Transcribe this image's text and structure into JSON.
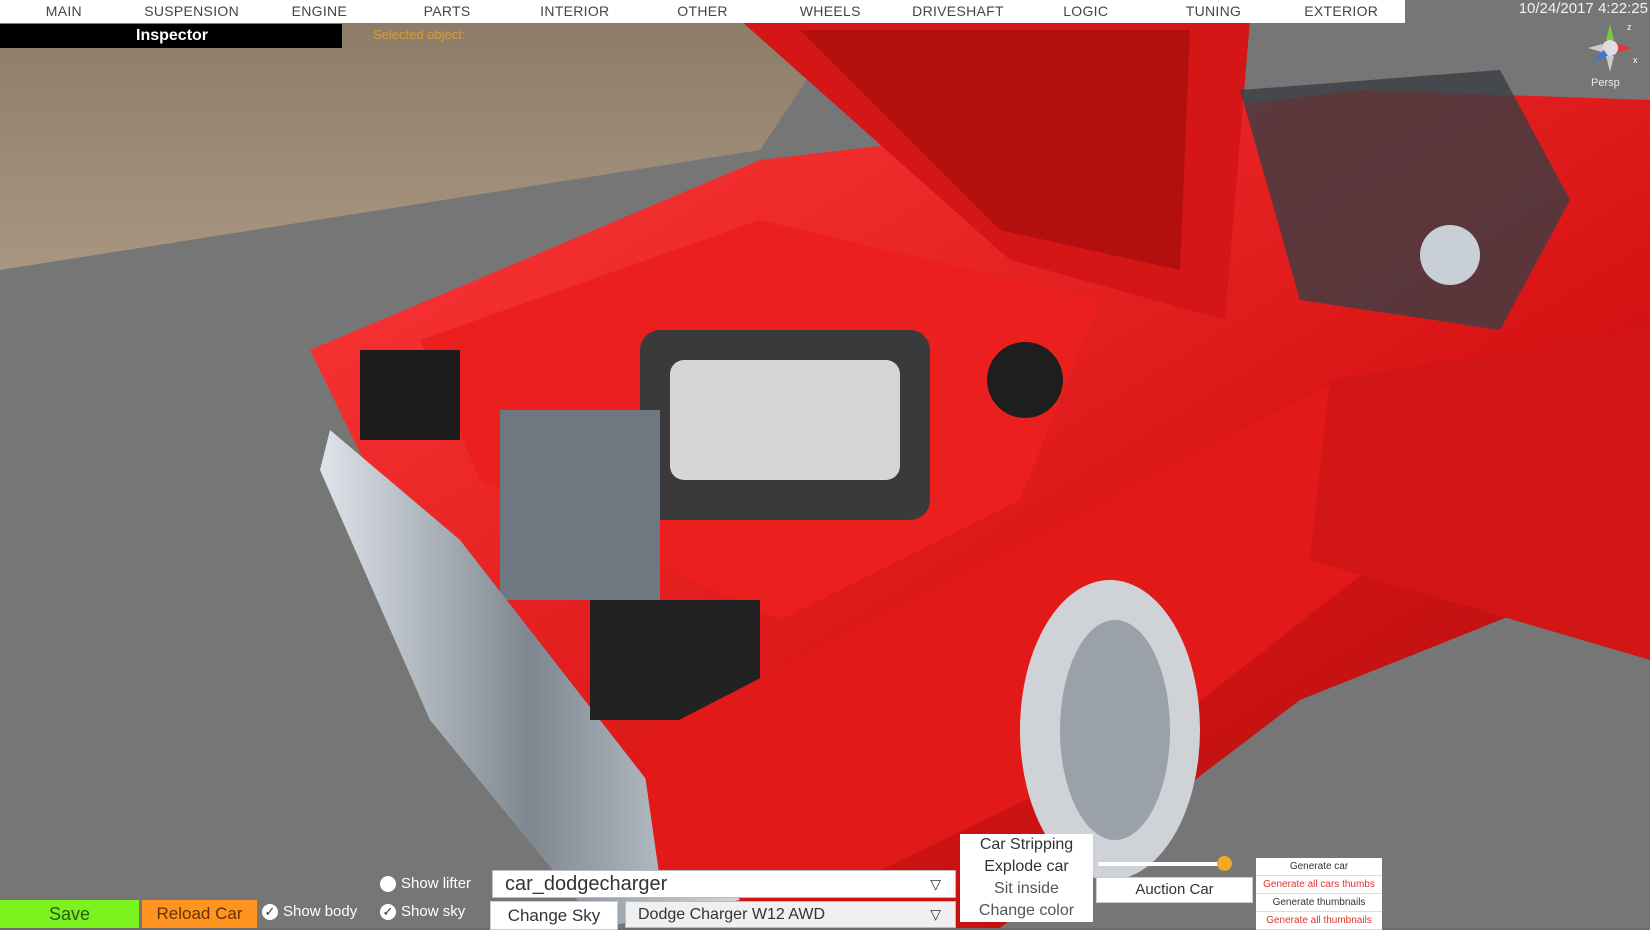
{
  "tabs": [
    "MAIN",
    "SUSPENSION",
    "ENGINE",
    "PARTS",
    "INTERIOR",
    "OTHER",
    "WHEELS",
    "DRIVESHAFT",
    "LOGIC",
    "TUNING",
    "EXTERIOR"
  ],
  "datetime": "10/24/2017 4:22:25",
  "gizmo": {
    "label": "Persp",
    "axis_x": "x",
    "axis_z": "z"
  },
  "inspector": {
    "title": "Inspector",
    "selected": "Selected object:"
  },
  "bottom": {
    "save": "Save",
    "reload": "Reload Car",
    "show_body": "Show body",
    "show_sky": "Show sky",
    "show_lifter": "Show lifter",
    "car_select": "car_dodgecharger",
    "change_sky": "Change Sky",
    "model_select": "Dodge Charger W12 AWD",
    "menu": [
      "Car Stripping",
      "Explode car",
      "Sit inside",
      "Change color"
    ],
    "auction": "Auction Car",
    "slider_value": 0.95,
    "generate": [
      "Generate car",
      "Generate all cars thumbs",
      "Generate thumbnails",
      "Generate all thumbnails"
    ],
    "show_body_checked": true,
    "show_sky_checked": true,
    "show_lifter_checked": false
  },
  "colors": {
    "car_red": "#e41b1b",
    "save_green": "#7cf21f",
    "reload_orange": "#ff9520",
    "accent": "#f5a623"
  }
}
